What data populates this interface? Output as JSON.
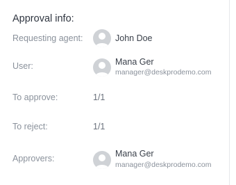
{
  "title": "Approval info:",
  "requesting_agent": {
    "label": "Requesting agent:",
    "name": "John Doe"
  },
  "user": {
    "label": "User:",
    "name": "Mana Ger",
    "email": "manager@deskprodemo.com"
  },
  "to_approve": {
    "label": "To approve:",
    "value": "1/1"
  },
  "to_reject": {
    "label": "To reject:",
    "value": "1/1"
  },
  "approvers": {
    "label": "Approvers:",
    "name": "Mana Ger",
    "email": "manager@deskprodemo.com"
  }
}
